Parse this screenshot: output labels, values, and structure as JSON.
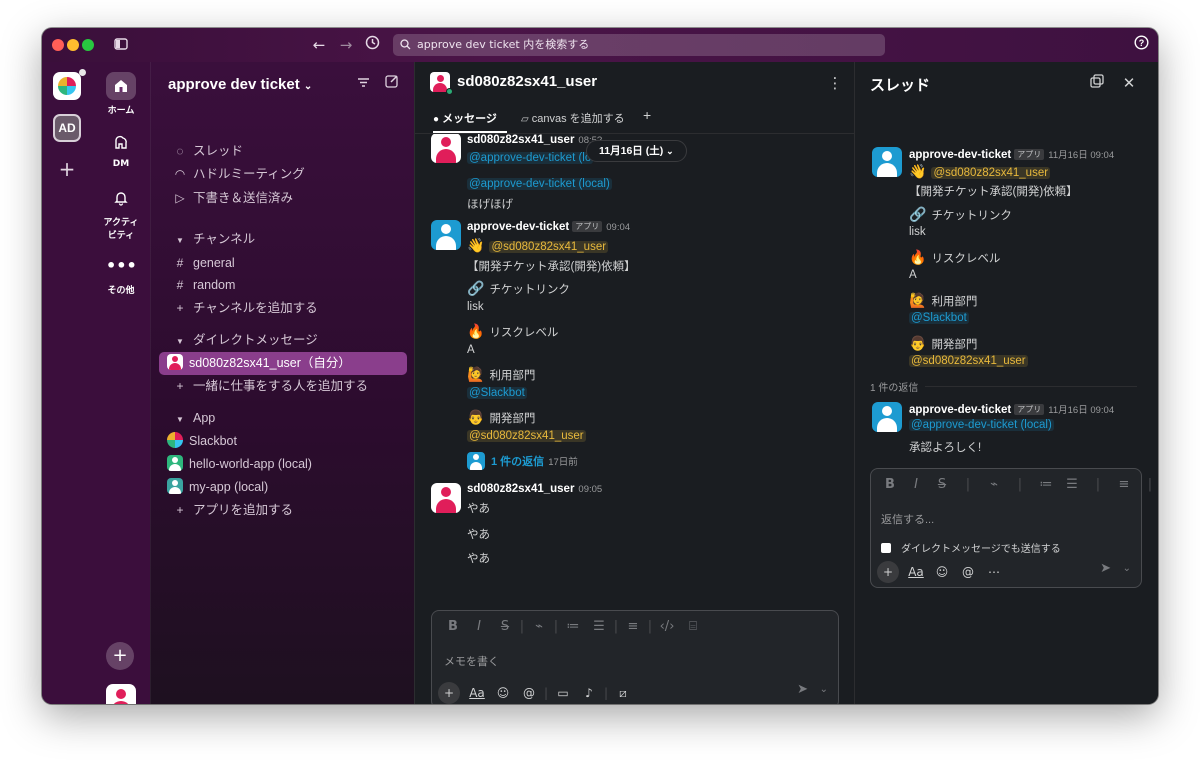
{
  "search": {
    "text": "approve dev ticket 内を検索する"
  },
  "workspace": {
    "initials": "AD",
    "name": "approve dev ticket"
  },
  "nav": {
    "home": "ホーム",
    "dm": "DM",
    "activity_1": "アクティ",
    "activity_2": "ビティ",
    "more": "その他"
  },
  "sidebar": {
    "top": [
      "スレッド",
      "ハドルミーティング",
      "下書き＆送信済み"
    ],
    "channels_header": "チャンネル",
    "channels": [
      "general",
      "random"
    ],
    "add_channel": "チャンネルを追加する",
    "dm_header": "ダイレクトメッセージ",
    "dm_self": "sd080z82sx41_user（自分）",
    "add_people": "一緒に仕事をする人を追加する",
    "app_header": "App",
    "apps": [
      "Slackbot",
      "hello-world-app (local)",
      "my-app (local)"
    ],
    "add_app": "アプリを追加する"
  },
  "channel": {
    "title": "sd080z82sx41_user",
    "tab_messages": "メッセージ",
    "tab_canvas": "canvas を追加する",
    "date_pill": "11月16日 (土)",
    "messages": [
      {
        "sender": "sd080z82sx41_user",
        "time": "08:5?",
        "line1": "@approve-dev-ticket (lo",
        "line2": "@approve-dev-ticket (local)",
        "line3": "ほげほげ"
      },
      {
        "sender": "approve-dev-ticket",
        "badge": "アプリ",
        "time": "09:04",
        "mention": "@sd080z82sx41_user",
        "title": "【開発チケット承認(開発)依頼】",
        "f1_label": "チケットリンク",
        "f1_value": "lisk",
        "f2_label": "リスクレベル",
        "f2_value": "A",
        "f3_label": "利用部門",
        "f3_value": "@Slackbot",
        "f4_label": "開発部門",
        "f4_value": "@sd080z82sx41_user",
        "reply_count": "1 件の返信",
        "reply_when": "17日前"
      },
      {
        "sender": "sd080z82sx41_user",
        "time": "09:05",
        "lines": [
          "やあ",
          "やあ",
          "やあ"
        ]
      }
    ],
    "composer_placeholder": "メモを書く"
  },
  "thread": {
    "title": "スレッド",
    "parent": {
      "sender": "approve-dev-ticket",
      "badge": "アプリ",
      "time": "11月16日 09:04",
      "mention": "@sd080z82sx41_user",
      "title": "【開発チケット承認(開発)依頼】",
      "f1_label": "チケットリンク",
      "f1_value": "lisk",
      "f2_label": "リスクレベル",
      "f2_value": "A",
      "f3_label": "利用部門",
      "f3_value": "@Slackbot",
      "f4_label": "開発部門",
      "f4_value": "@sd080z82sx41_user"
    },
    "reply_divider": "1 件の返信",
    "reply": {
      "sender": "approve-dev-ticket",
      "badge": "アプリ",
      "time": "11月16日 09:04",
      "mention": "@approve-dev-ticket (local)",
      "text": "承認よろしく!"
    },
    "composer_placeholder": "返信する...",
    "also_send": "ダイレクトメッセージでも送信する"
  },
  "colors": {
    "rail": "#3b0e3c",
    "active_item": "#8a3e8c",
    "background": "#1a1d21",
    "link": "#1d9bd1",
    "self_mention": "#e8b93c",
    "online": "#2bac76"
  }
}
